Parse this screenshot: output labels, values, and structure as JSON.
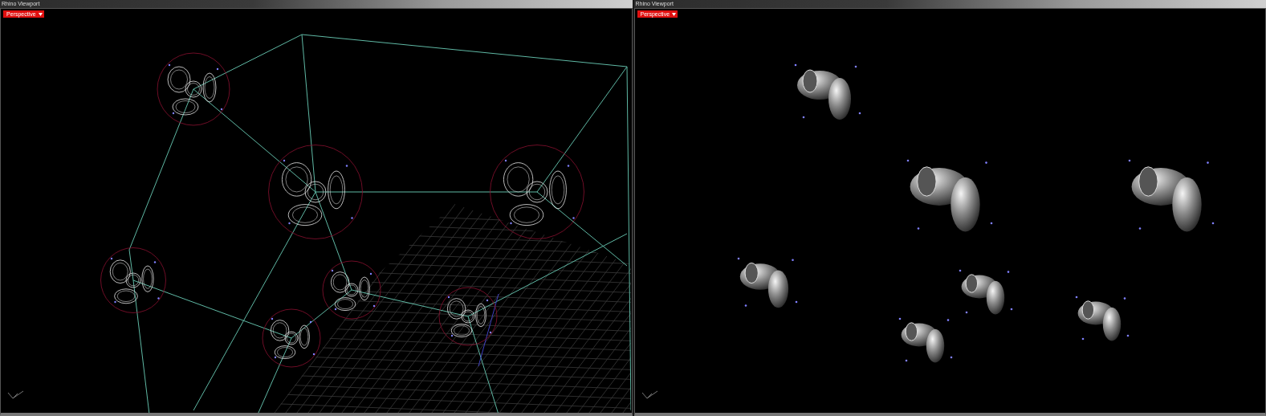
{
  "viewports": [
    {
      "title": "Rhino Viewport",
      "view_label": "Perspective",
      "kind": "wireframe"
    },
    {
      "title": "Rhino Viewport",
      "view_label": "Perspective",
      "kind": "rendered"
    }
  ]
}
